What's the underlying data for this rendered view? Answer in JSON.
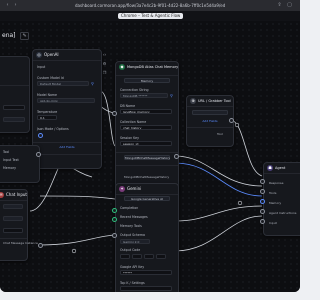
{
  "browser": {
    "url": "dashboard.cormoran.app/flow/3a7e4c2b-9f01-4d22-8a6b-7ff0c1e5d4a9/edit",
    "banner": "Chrome – Test & Agentic Flow"
  },
  "page": {
    "title_partial": "ena]"
  },
  "nodes": {
    "left_top": {
      "title": "OpenAI",
      "sub": "Generates text using OpenAI LLMs",
      "fields": [
        {
          "label": "Input",
          "value": ""
        },
        {
          "label": "Custom Model Id",
          "value": "Default Model"
        },
        {
          "label": "Model Name",
          "value": "gpt-4o-mini"
        },
        {
          "label": "Temperature",
          "value": "0.1"
        },
        {
          "label": "Json Mode / Options",
          "value": ""
        }
      ],
      "button": "Add Fields"
    },
    "mongo": {
      "title": "MongoDB Atlas Chat Memory",
      "sub": "Retrieves chat history",
      "fields": [
        {
          "label": "Session Id",
          "value": ""
        },
        {
          "label": "Connection String",
          "value": "MongoDB ******"
        },
        {
          "label": "DB Name",
          "value": "langflow_memory"
        },
        {
          "label": "Collection Name",
          "value": "chat_history"
        },
        {
          "label": "Session Key",
          "value": "session_id"
        }
      ],
      "outputs": [
        "Memory",
        "MongoDBChatMessageHistory"
      ]
    },
    "url_tool": {
      "title": "URL / Grabber Tool",
      "sub": "Fetch content from URLs",
      "button": "Add Fields",
      "output": "Tool"
    },
    "agent": {
      "title": "Agent",
      "sub": "Define the agent's instructions",
      "fields": [
        "Language Model",
        "Provider",
        "Model Name"
      ],
      "outputs": [
        "Response",
        "Tools",
        "Memory",
        "Agent Instructions",
        "Input"
      ]
    },
    "center": {
      "title": "Gemini",
      "sub": "Google Generative AI",
      "fields": [
        {
          "label": "Input",
          "value": ""
        },
        {
          "label": "Structured Output",
          "value": ""
        },
        {
          "label": "Top K / Settings",
          "value": ""
        },
        {
          "label": "Model Name",
          "value": "Gemini 2.0"
        },
        {
          "label": "Google API Key",
          "value": "******"
        }
      ],
      "outputs": [
        "Completion",
        "Recent Messages",
        "Memory Tools",
        "Output Schema",
        "Output Code"
      ]
    },
    "bottom_left": {
      "title": "Chat Input",
      "fields": [
        "Text",
        "Files",
        "Sender"
      ],
      "output": "Chat Message Instance"
    },
    "left_mid": {
      "rows": [
        "Tool",
        "Input Text",
        "Memory"
      ]
    }
  },
  "edge_colors": {
    "default": "#cfd3da",
    "accent": "#5b8cff"
  }
}
